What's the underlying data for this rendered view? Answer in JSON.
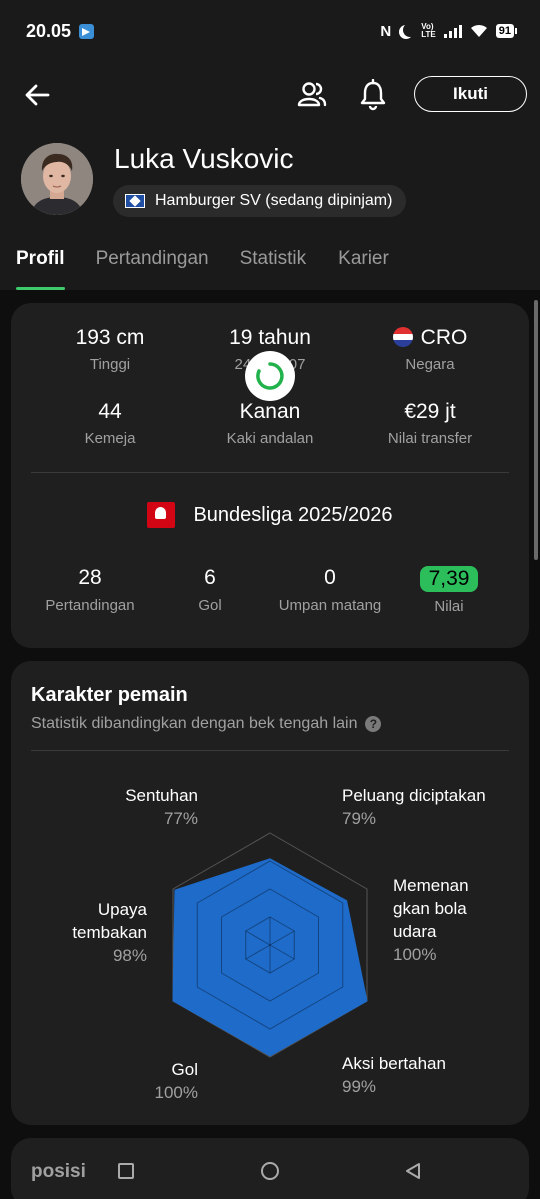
{
  "status_bar": {
    "time": "20.05",
    "volte_label": "Vo)) LTE",
    "network": "4G",
    "battery": "91"
  },
  "header": {
    "follow_label": "Ikuti"
  },
  "player": {
    "name": "Luka Vuskovic",
    "club": "Hamburger SV (sedang dipinjam)"
  },
  "tabs": [
    {
      "label": "Profil",
      "active": true
    },
    {
      "label": "Pertandingan",
      "active": false
    },
    {
      "label": "Statistik",
      "active": false
    },
    {
      "label": "Karier",
      "active": false
    }
  ],
  "info": {
    "height": {
      "value": "193 cm",
      "label": "Tinggi"
    },
    "age": {
      "value": "19 tahun",
      "label": "24 ... 2007"
    },
    "country": {
      "value": "CRO",
      "label": "Negara"
    },
    "shirt": {
      "value": "44",
      "label": "Kemeja"
    },
    "foot": {
      "value": "Kanan",
      "label": "Kaki andalan"
    },
    "transfer": {
      "value": "€29 jt",
      "label": "Nilai transfer"
    }
  },
  "league": {
    "name": "Bundesliga 2025/2026",
    "stats": [
      {
        "value": "28",
        "label": "Pertandingan"
      },
      {
        "value": "6",
        "label": "Gol"
      },
      {
        "value": "0",
        "label": "Umpan matang"
      },
      {
        "value": "7,39",
        "label": "Nilai"
      }
    ]
  },
  "character": {
    "title": "Karakter pemain",
    "subtitle": "Statistik dibandingkan dengan bek tengah lain",
    "axes": [
      {
        "name": "Sentuhan",
        "pct": "77%",
        "value": 77
      },
      {
        "name": "Peluang diciptakan",
        "pct": "79%",
        "value": 79
      },
      {
        "name": "Memenan gkan bola udara",
        "line1": "Memenan",
        "line2": "gkan bola",
        "line3": "udara",
        "pct": "100%",
        "value": 100
      },
      {
        "name": "Aksi bertahan",
        "pct": "99%",
        "value": 99
      },
      {
        "name": "Gol",
        "pct": "100%",
        "value": 100
      },
      {
        "name": "Upaya tembakan",
        "line1": "Upaya",
        "line2": "tembakan",
        "pct": "98%",
        "value": 98
      }
    ],
    "fill_color": "#1e6bc9"
  },
  "bottom": {
    "label": "posisi"
  }
}
